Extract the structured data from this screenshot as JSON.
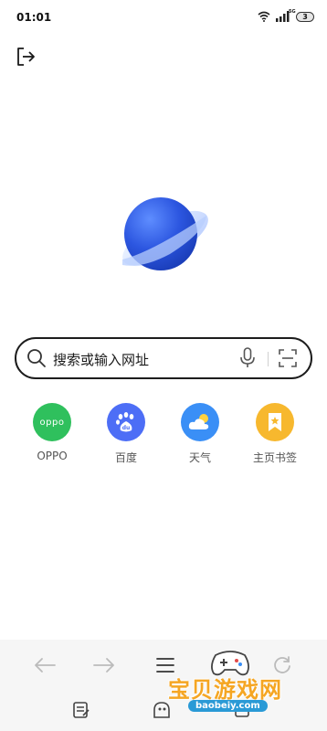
{
  "status_bar": {
    "time": "01:01",
    "network": "5G",
    "battery": "3"
  },
  "icons": {
    "exit": "exit-icon",
    "planet": "planet-logo-icon",
    "search": "search-icon",
    "mic": "mic-icon",
    "scan": "scan-icon"
  },
  "search": {
    "placeholder": "搜索或输入网址"
  },
  "shortcuts": [
    {
      "label": "OPPO",
      "icon": "oppo-icon",
      "color": "#2fc05d",
      "icon_text": "oppo"
    },
    {
      "label": "百度",
      "icon": "baidu-paw-icon",
      "color": "#4d6ef6"
    },
    {
      "label": "天气",
      "icon": "weather-icon",
      "color": "#3a8ff6"
    },
    {
      "label": "主页书签",
      "icon": "bookmark-icon",
      "color": "#f7b82e"
    }
  ],
  "bottom_nav": [
    "back-arrow-icon",
    "forward-arrow-icon",
    "menu-icon",
    "refresh-icon",
    "notes-icon",
    "home-icon",
    "tabs-icon"
  ],
  "watermark": {
    "text": "宝贝游戏网",
    "url": "baobeiy.com"
  },
  "colors": {
    "accent_blue": "#3b6cf0",
    "oppo_green": "#2fc05d",
    "baidu_blue": "#4d6ef6",
    "weather_blue": "#3a8ff6",
    "bookmark_yellow": "#f7b82e"
  }
}
